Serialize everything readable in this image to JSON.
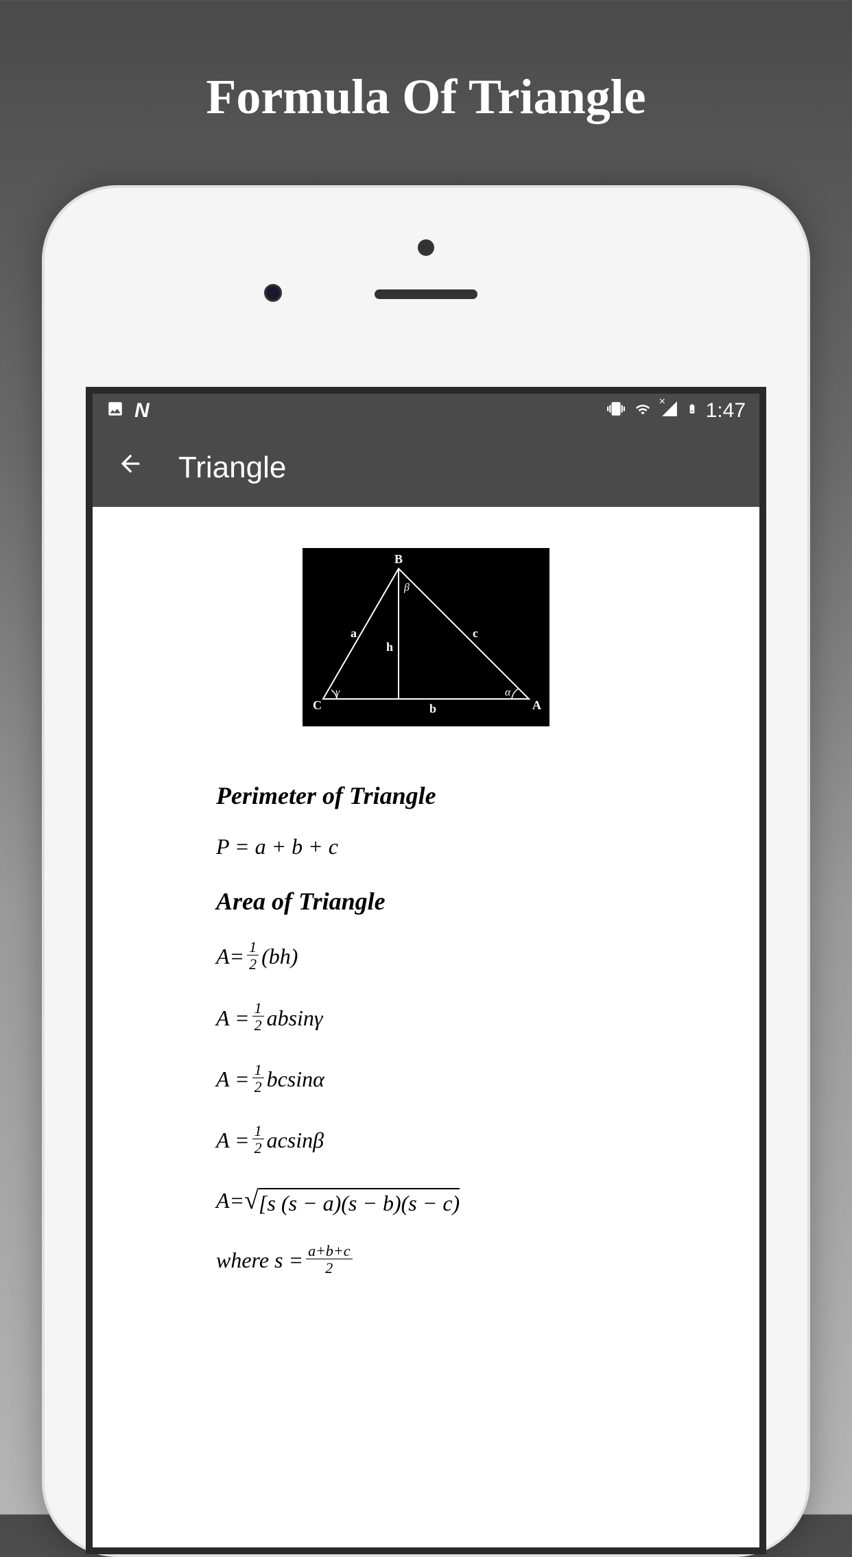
{
  "pageTitle": "Formula Of Triangle",
  "statusBar": {
    "time": "1:47"
  },
  "appBar": {
    "title": "Triangle"
  },
  "diagram": {
    "vertices": {
      "A": "A",
      "B": "B",
      "C": "C"
    },
    "sides": {
      "a": "a",
      "b": "b",
      "c": "c"
    },
    "height": "h",
    "angles": {
      "alpha": "α",
      "beta": "β",
      "gamma": "γ"
    }
  },
  "sections": {
    "perimeter": {
      "heading": "Perimeter of Triangle",
      "formula": "P = a + b + c"
    },
    "area": {
      "heading": "Area of Triangle",
      "formulas": {
        "basic": {
          "lhs": "A= ",
          "numerator": "1",
          "denominator": "2",
          "rhs": "(bh)"
        },
        "siny": {
          "lhs": "A = ",
          "numerator": "1",
          "denominator": "2",
          "rhs": " absinγ"
        },
        "sina": {
          "lhs": "A = ",
          "numerator": "1",
          "denominator": "2",
          "rhs": " bcsinα"
        },
        "sinb": {
          "lhs": "A = ",
          "numerator": "1",
          "denominator": "2",
          "rhs": " acsinβ"
        },
        "heron": {
          "lhs": "A= ",
          "content": "[s (s − a)(s − b)(s − c)"
        },
        "where": {
          "text": "where s = ",
          "numerator": "a+b+c",
          "denominator": "2"
        }
      }
    }
  }
}
